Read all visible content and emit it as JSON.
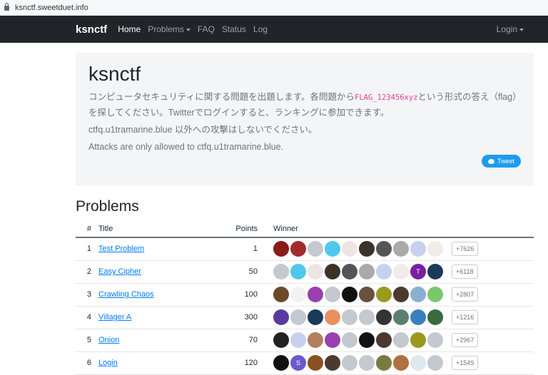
{
  "browser": {
    "url": "ksnctf.sweetduet.info"
  },
  "nav": {
    "brand": "ksnctf",
    "items": [
      "Home",
      "Problems",
      "FAQ",
      "Status",
      "Log"
    ],
    "login": "Login"
  },
  "jumbotron": {
    "title": "ksnctf",
    "intro_before": "コンピュータセキュリティに関する問題を出題します。各問題から",
    "flag_format": "FLAG_123456xyz",
    "intro_after": "という形式の答え（flag）を探してください。Twitterでログインすると、ランキングに参加できます。",
    "warning_ja": "ctfq.u1tramarine.blue 以外への攻撃はしないでください。",
    "warning_en": "Attacks are only allowed to ctfq.u1tramarine.blue.",
    "tweet": "Tweet"
  },
  "problems": {
    "heading": "Problems",
    "columns": [
      "#",
      "Title",
      "Points",
      "Winner"
    ],
    "rows": [
      {
        "id": "1",
        "title": "Test Problem",
        "points": "1",
        "more": "+7626",
        "avatars": [
          "#8b1a1a",
          "#a52a2a",
          "#c3c9cf",
          "#4fc8ec",
          "#efe4e4",
          "#3a3326",
          "#555555",
          "#aaaaaa",
          "#c8d0f0",
          "#f0ece8"
        ]
      },
      {
        "id": "2",
        "title": "Easy Cipher",
        "points": "50",
        "more": "+6118",
        "avatars": [
          "#c3c9cf",
          "#4fc8ec",
          "#efe4e4",
          "#3a3326",
          "#555555",
          "#aaaaaa",
          "#c8d0f0",
          "#f0ece8",
          "#7b1fa2|T",
          "#1a3a5a"
        ]
      },
      {
        "id": "3",
        "title": "Crawling Chaos",
        "points": "100",
        "more": "+2807",
        "avatars": [
          "#6b4a2a",
          "#f2f2f2",
          "#9a3fb0",
          "#c3c9cf",
          "#111111",
          "#6a5040",
          "#9a9a20",
          "#4a3a30",
          "#8ab0d0",
          "#7bc86c"
        ]
      },
      {
        "id": "4",
        "title": "Villager A",
        "points": "300",
        "more": "+1216",
        "avatars": [
          "#5a3aa0",
          "#c3c9cf",
          "#1a3a5a",
          "#e89060",
          "#c3c9cf",
          "#c3c9cf",
          "#333333",
          "#5a8070",
          "#3a80c0",
          "#3a6a40"
        ]
      },
      {
        "id": "5",
        "title": "Onion",
        "points": "70",
        "more": "+2967",
        "avatars": [
          "#222222",
          "#c8d0f0",
          "#b08060",
          "#9a3fb0",
          "#c3c9cf",
          "#111111",
          "#4a3a30",
          "#c3c9cf",
          "#9a9a20",
          "#c3c9cf"
        ]
      },
      {
        "id": "6",
        "title": "Login",
        "points": "120",
        "more": "+1549",
        "avatars": [
          "#111111",
          "#6a5acd|S",
          "#8a5020",
          "#4a3a30",
          "#c3c9cf",
          "#c3c9cf",
          "#7a7a40",
          "#b07040",
          "#e0e8f0",
          "#c3c9cf"
        ]
      }
    ]
  }
}
